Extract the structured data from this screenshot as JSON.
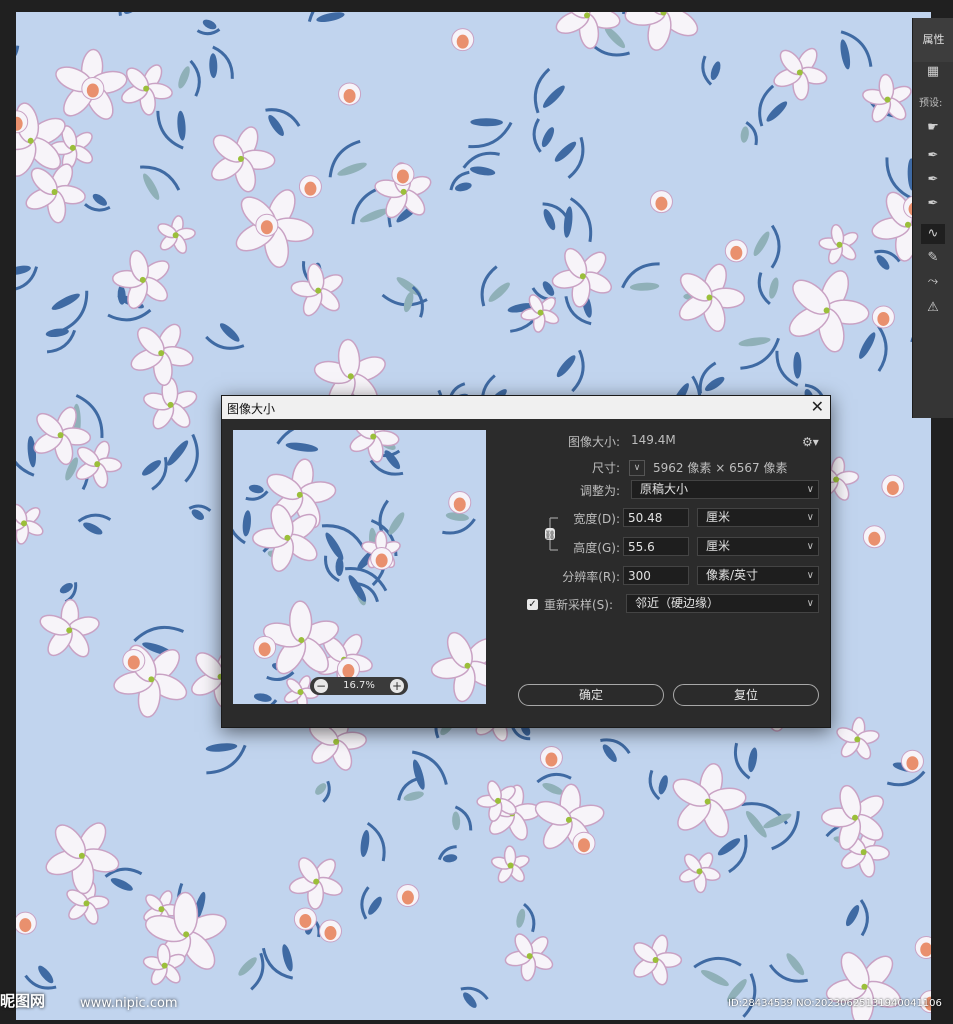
{
  "properties_panel": {
    "tab_label": "属性",
    "preset_label": "预设:"
  },
  "dialog": {
    "title": "图像大小",
    "image_size_label": "图像大小:",
    "image_size_value": "149.4M",
    "dimensions_label": "尺寸:",
    "dim_width": "5962",
    "dim_unit1": "像素",
    "dim_times": "×",
    "dim_height": "6567",
    "dim_unit2": "像素",
    "fit_to_label": "调整为:",
    "fit_to_value": "原稿大小",
    "width_label": "宽度(D):",
    "width_value": "50.48",
    "width_unit": "厘米",
    "height_label": "高度(G):",
    "height_value": "55.6",
    "height_unit": "厘米",
    "resolution_label": "分辨率(R):",
    "resolution_value": "300",
    "resolution_unit": "像素/英寸",
    "resample_label": "重新采样(S):",
    "resample_value": "邻近（硬边缘）",
    "zoom_value": "16.7%",
    "ok_label": "确定",
    "reset_label": "复位"
  },
  "watermark": {
    "site_cn": "昵图网",
    "site_url": "www.nipic.com",
    "image_id": "ID:28434539 NO:20230625131940041106"
  },
  "colors": {
    "canvas_bg": "#c1d4ee",
    "leaf_blue": "#3f6aa3",
    "petal": "#f7f4f9",
    "petal_edge": "#c9a2c4",
    "bud_orange": "#e9906e",
    "leaf_sage": "#8fb0b8"
  }
}
